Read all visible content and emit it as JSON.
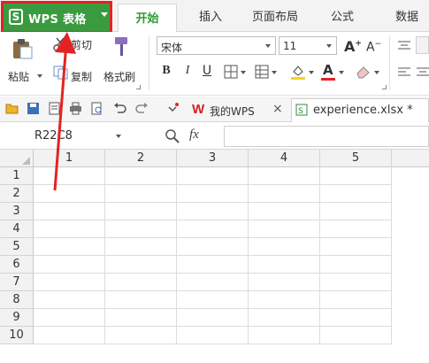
{
  "app": {
    "name": "WPS 表格",
    "logo_letter": "S"
  },
  "top_tabs": [
    {
      "label": "开始",
      "active": true
    },
    {
      "label": "插入"
    },
    {
      "label": "页面布局"
    },
    {
      "label": "公式"
    },
    {
      "label": "数据"
    }
  ],
  "ribbon": {
    "cut_label": "剪切",
    "paste_label": "粘贴",
    "copy_label": "复制",
    "format_painter_label": "格式刷",
    "font_name": "宋体",
    "font_size": "11",
    "bold": "B",
    "italic": "I",
    "underline": "U",
    "grow_font": "A",
    "shrink_font": "A",
    "font_color_letter": "A"
  },
  "doc_tabs": [
    {
      "label": "我的WPS",
      "close": "×"
    },
    {
      "label": "experience.xlsx *"
    }
  ],
  "formula_bar": {
    "name_box": "R22C8",
    "fx": "fx",
    "value": ""
  },
  "sheet": {
    "columns": [
      "1",
      "2",
      "3",
      "4",
      "5"
    ],
    "rows": [
      "1",
      "2",
      "3",
      "4",
      "5",
      "6",
      "7",
      "8",
      "9",
      "10"
    ]
  },
  "colors": {
    "brand_green": "#3a9a3f",
    "highlight_red": "#e52222",
    "active_tab_text": "#2f9b35"
  }
}
